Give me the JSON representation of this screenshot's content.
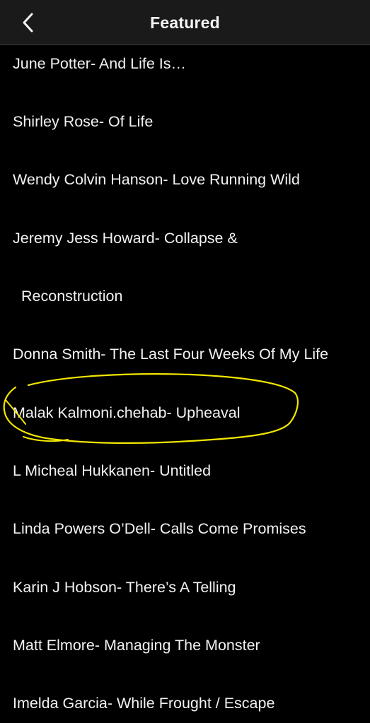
{
  "header": {
    "title": "Featured",
    "back_icon": "chevron-left-icon"
  },
  "items": [
    "June Potter- And Life Is…",
    "Shirley Rose- Of Life",
    "Wendy Colvin Hanson- Love Running Wild",
    "Jeremy Jess Howard- Collapse &",
    "Reconstruction",
    "Donna Smith- The Last Four Weeks Of My Life",
    "Malak Kalmoni.chehab- Upheaval",
    "L Micheal Hukkanen- Untitled",
    "Linda Powers O’Dell- Calls Come Promises",
    "Karin J Hobson- There’s A Telling",
    "Matt Elmore- Managing The Monster",
    "Imelda Garcia- While Frought / Escape"
  ],
  "colors": {
    "background": "#000000",
    "header": "#1a1a1a",
    "text": "#f2f2f2",
    "annotation": "#f2e600"
  }
}
